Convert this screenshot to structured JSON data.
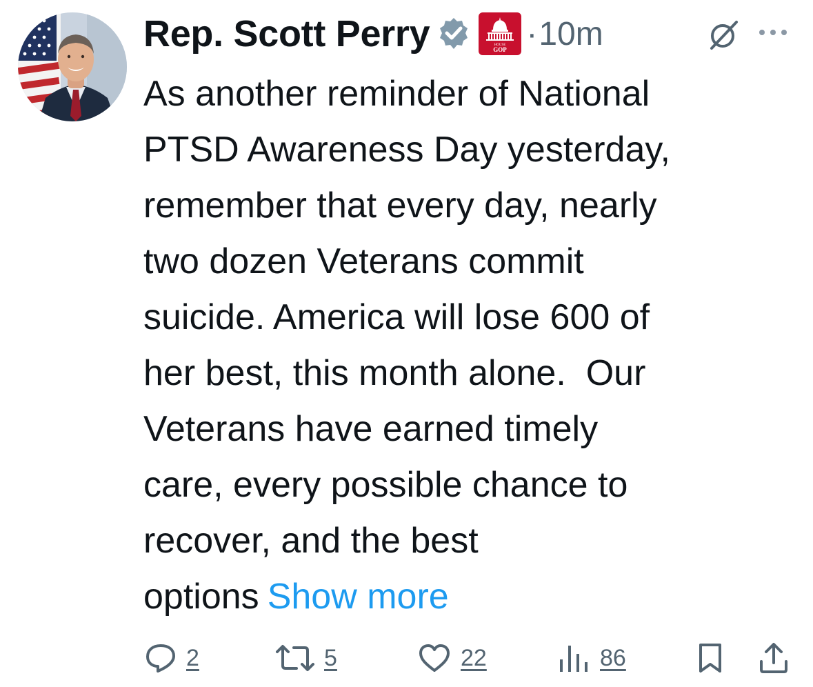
{
  "author": {
    "display_name": "Rep. Scott Perry",
    "verified_icon": "verified-badge-icon",
    "affiliate_badge_icon": "house-gop-badge",
    "affiliate_badge_text": "HOUSE GOP"
  },
  "meta": {
    "separator": "·",
    "time": "10m"
  },
  "tweet": {
    "lines": [
      "As another reminder of National",
      "PTSD Awareness Day yesterday,",
      "remember that every day, nearly",
      "two dozen Veterans commit",
      "suicide. America will lose 600 of",
      "her best, this month alone.  Our",
      "Veterans have earned timely",
      "care, every possible chance to",
      "recover, and the best",
      "options"
    ],
    "show_more": "Show more"
  },
  "actions": {
    "replies": "2",
    "reposts": "5",
    "likes": "22",
    "views": "86"
  },
  "colors": {
    "text": "#0f1419",
    "secondary": "#536471",
    "link": "#1d9bf0",
    "verified_badge": "#829aab",
    "gop_red": "#c8102e"
  }
}
